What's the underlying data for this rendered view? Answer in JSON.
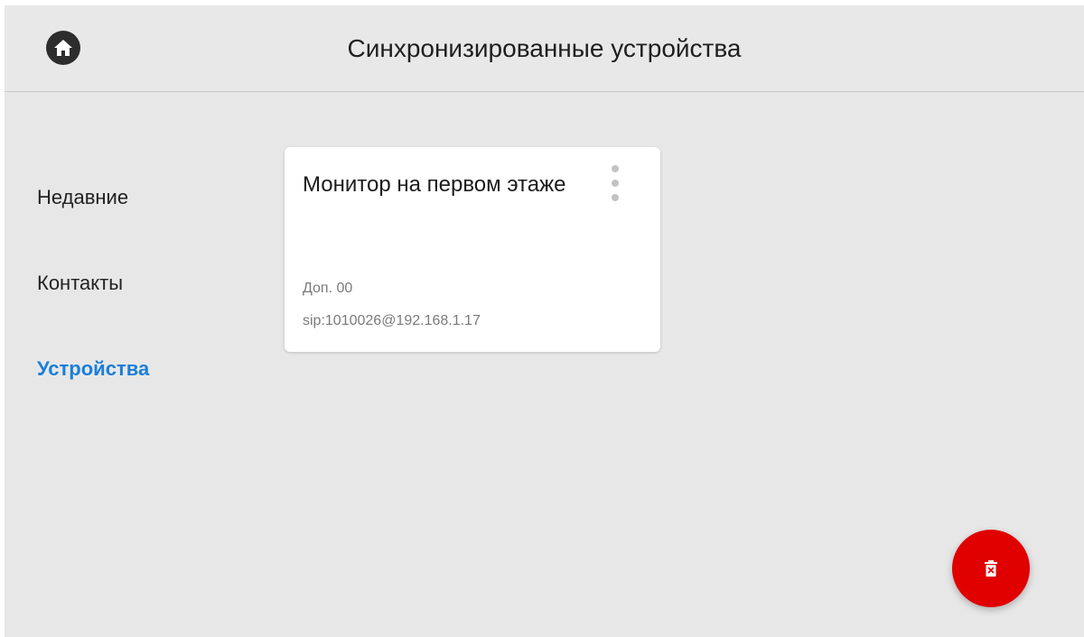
{
  "header": {
    "title": "Синхронизированные устройства",
    "home_icon": "home-icon"
  },
  "sidebar": {
    "items": [
      {
        "label": "Недавние",
        "active": false
      },
      {
        "label": "Контакты",
        "active": false
      },
      {
        "label": "Устройства",
        "active": true
      }
    ]
  },
  "device": {
    "name": "Монитор на первом этаже",
    "extension": "Доп. 00",
    "sip": "sip:1010026@192.168.1.17",
    "menu_icon": "more-vert-icon"
  },
  "actions": {
    "delete_icon": "delete-icon"
  },
  "colors": {
    "accent": "#1a7fd8",
    "danger": "#e00000",
    "background": "#e7e7e7"
  }
}
